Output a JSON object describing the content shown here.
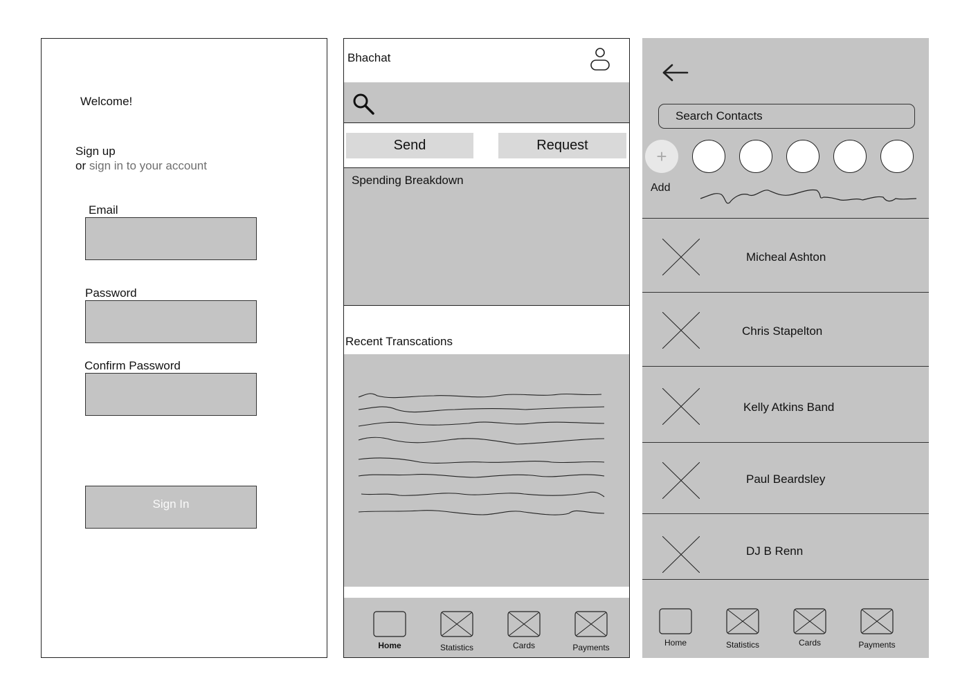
{
  "signup": {
    "welcome": "Welcome!",
    "heading": "Sign up",
    "or_text": "or",
    "signin_link": "sign in to your account",
    "email_label": "Email",
    "email_value": "",
    "password_label": "Password",
    "password_value": "",
    "confirm_label": "Confirm Password",
    "confirm_value": "",
    "submit_label": "Sign In"
  },
  "home": {
    "app_title": "Bhachat",
    "profile_icon": "user-profile-icon",
    "search_icon": "magnifier-icon",
    "send_label": "Send",
    "request_label": "Request",
    "spending_title": "Spending Breakdown",
    "recent_title": "Recent Transcations"
  },
  "nav": {
    "home": "Home",
    "statistics": "Statistics",
    "cards": "Cards",
    "payments": "Payments",
    "active": "Home"
  },
  "contacts": {
    "back_icon": "arrow-left-icon",
    "search_placeholder": "Search Contacts",
    "add_symbol": "+",
    "add_label": "Add",
    "items": [
      {
        "name": "Micheal Ashton"
      },
      {
        "name": "Chris Stapelton"
      },
      {
        "name": "Kelly Atkins Band"
      },
      {
        "name": "Paul Beardsley"
      },
      {
        "name": "DJ B Renn"
      }
    ]
  },
  "colors": {
    "fill_gray": "#c4c4c4",
    "button_gray": "#d9d9d9",
    "border": "#222222",
    "muted_text": "#6f6f6f"
  }
}
